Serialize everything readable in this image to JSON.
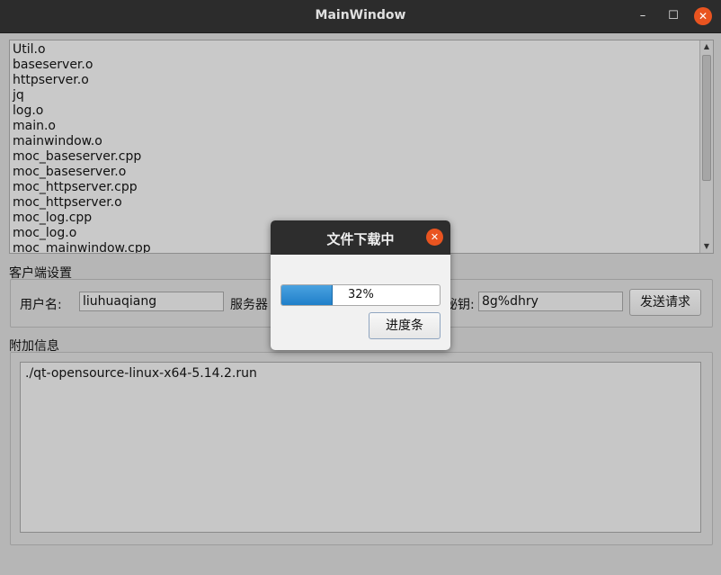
{
  "window": {
    "title": "MainWindow",
    "controls": {
      "minimize": "–",
      "maximize": "☐",
      "close": "✕"
    }
  },
  "file_list": {
    "items": [
      "Util.o",
      "baseserver.o",
      "httpserver.o",
      "jq",
      "log.o",
      "main.o",
      "mainwindow.o",
      "moc_baseserver.cpp",
      "moc_baseserver.o",
      "moc_httpserver.cpp",
      "moc_httpserver.o",
      "moc_log.cpp",
      "moc_log.o",
      "moc_mainwindow.cpp"
    ]
  },
  "client_settings": {
    "title": "客户端设置",
    "username_label": "用户名:",
    "username_value": "liuhuaqiang",
    "server_label": "服务器",
    "key_label": "秘钥:",
    "key_value": "8g%dhry",
    "send_button": "发送请求"
  },
  "extra_info": {
    "title": "附加信息",
    "text": "./qt-opensource-linux-x64-5.14.2.run"
  },
  "dialog": {
    "title": "文件下载中",
    "close": "✕",
    "progress_text": "32%",
    "progress_value": 32,
    "button": "进度条"
  },
  "colors": {
    "accent_close": "#e95420",
    "progress_fill": "#2a8bd6"
  }
}
